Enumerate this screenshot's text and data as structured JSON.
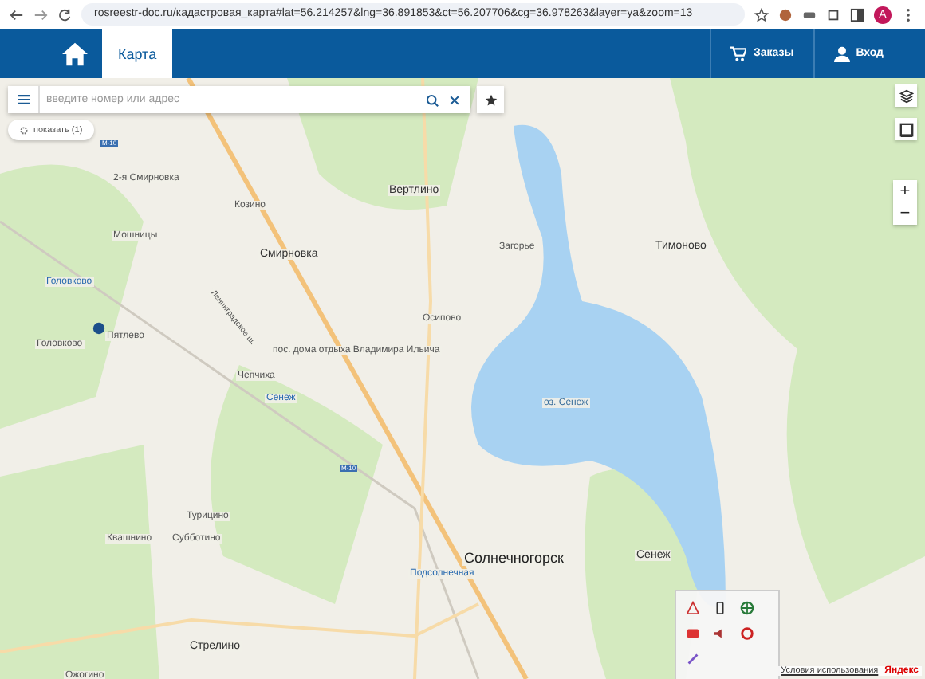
{
  "browser": {
    "url": "rosreestr-doc.ru/кадастровая_карта#lat=56.214257&lng=36.891853&ct=56.207706&cg=36.978263&layer=ya&zoom=13",
    "avatar": "A"
  },
  "header": {
    "tabs": [
      {
        "label": "Карта",
        "selected": true
      }
    ],
    "actions": [
      {
        "kind": "cart",
        "label": "Заказы"
      },
      {
        "kind": "user",
        "label": "Вход"
      }
    ]
  },
  "search": {
    "placeholder": "введите номер или адрес"
  },
  "show_button": {
    "label": "показать (1)"
  },
  "zoom_controls": [
    "+",
    "−"
  ],
  "map": {
    "labels": [
      {
        "text": "2-я Смирновка",
        "kind": "village"
      },
      {
        "text": "Козино",
        "kind": "village"
      },
      {
        "text": "Вертлино",
        "kind": "town"
      },
      {
        "text": "Мошницы",
        "kind": "village"
      },
      {
        "text": "Смирновка",
        "kind": "town"
      },
      {
        "text": "Головково",
        "kind": "station"
      },
      {
        "text": "Пятлево",
        "kind": "village"
      },
      {
        "text": "Головково",
        "kind": "village"
      },
      {
        "text": "Осипово",
        "kind": "village"
      },
      {
        "text": "пос. дома отдыха Владимира Ильича",
        "kind": "village"
      },
      {
        "text": "Чепчиха",
        "kind": "village"
      },
      {
        "text": "Сенеж",
        "kind": "station"
      },
      {
        "text": "Загорье",
        "kind": "village"
      },
      {
        "text": "Тимоново",
        "kind": "town"
      },
      {
        "text": "оз. Сенеж",
        "kind": "water"
      },
      {
        "text": "Турицино",
        "kind": "village"
      },
      {
        "text": "Квашнино",
        "kind": "village"
      },
      {
        "text": "Субботино",
        "kind": "village"
      },
      {
        "text": "Подсолнечная",
        "kind": "station"
      },
      {
        "text": "Солнечногорск",
        "kind": "city"
      },
      {
        "text": "Сенеж",
        "kind": "town"
      },
      {
        "text": "Стрелино",
        "kind": "town"
      },
      {
        "text": "Ожогино",
        "kind": "village"
      },
      {
        "text": "Ленинградское ш.",
        "kind": "road"
      },
      {
        "text": "M-10",
        "kind": "shield"
      },
      {
        "text": "M-10",
        "kind": "shield"
      }
    ],
    "marker": {
      "selected": true
    },
    "attribution": [
      {
        "text": "Условия использования",
        "kind": "link"
      },
      {
        "text": "Яндекс",
        "kind": "brand"
      }
    ]
  }
}
